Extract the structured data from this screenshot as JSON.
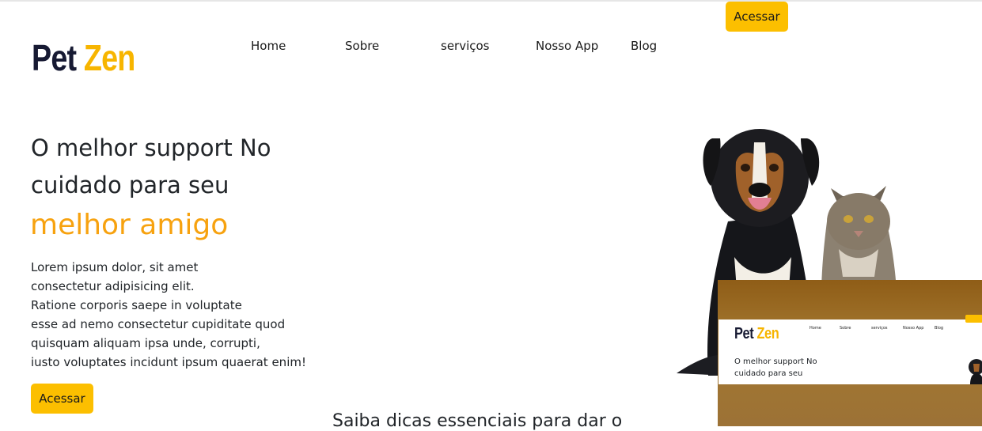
{
  "brand": {
    "name_part1": "Pet",
    "name_part2": "Zen"
  },
  "nav": {
    "items": [
      "Home",
      "Sobre",
      "serviços",
      "Nosso App",
      "Blog"
    ]
  },
  "header": {
    "cta_label": "Acessar"
  },
  "hero": {
    "line1": "O melhor support No",
    "line2": "cuidado para seu",
    "accent": "melhor amigo",
    "description": [
      "Lorem ipsum dolor, sit amet",
      "consectetur adipisicing elit.",
      "Ratione corporis saepe in voluptate",
      "esse ad nemo consectetur cupiditate quod",
      "quisquam aliquam ipsa unde, corrupti,",
      "iusto voluptates incidunt ipsum quaerat enim!"
    ],
    "cta_label": "Acessar"
  },
  "tips_heading": "Saiba dicas essenciais para dar o",
  "preview": {
    "brand_part1": "Pet",
    "brand_part2": "Zen",
    "nav": [
      "Home",
      "Sobre",
      "serviços",
      "Nosso App",
      "Blog"
    ],
    "line1": "O melhor support No",
    "line2": "cuidado para seu"
  },
  "colors": {
    "accent": "#f7a20f",
    "button": "#fcbf00",
    "brand_dark": "#171a33"
  },
  "icons": {
    "hero_image": "dog-and-cat-image"
  }
}
